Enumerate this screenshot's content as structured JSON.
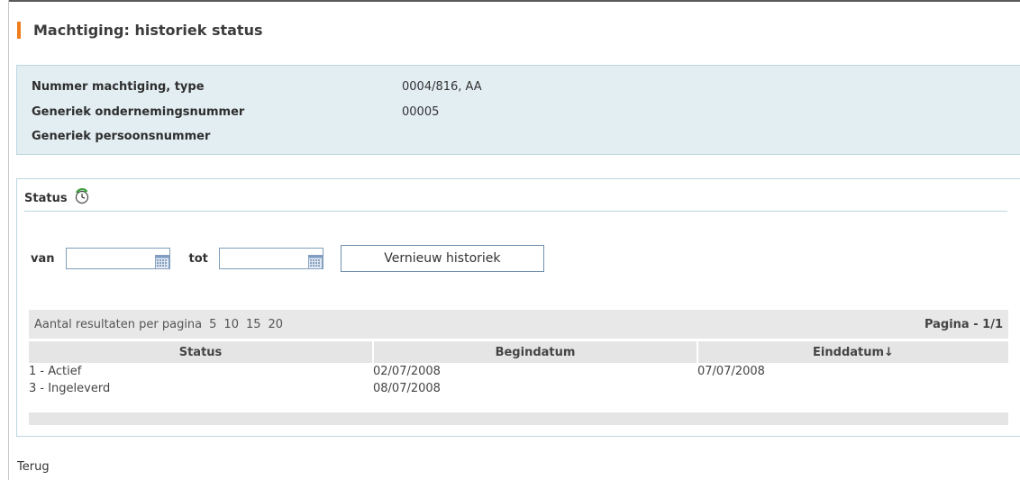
{
  "page": {
    "title": "Machtiging: historiek status"
  },
  "info": {
    "rows": [
      {
        "label": "Nummer machtiging, type",
        "value": "0004/816, AA"
      },
      {
        "label": "Generiek ondernemingsnummer",
        "value": "00005"
      },
      {
        "label": "Generiek persoonsnummer",
        "value": ""
      }
    ]
  },
  "status_section": {
    "title": "Status",
    "refresh_icon": "refresh-icon",
    "from_label": "van",
    "to_label": "tot",
    "from_value": "",
    "to_value": "",
    "renew_button": "Vernieuw historiek"
  },
  "pager": {
    "label": "Aantal resultaten per pagina",
    "options": [
      "5",
      "10",
      "15",
      "20"
    ],
    "page_info": "Pagina - 1/1"
  },
  "table": {
    "columns": [
      "Status",
      "Begindatum",
      "Einddatum↓"
    ],
    "rows": [
      [
        "1  - Actief",
        "02/07/2008",
        "07/07/2008"
      ],
      [
        "3  - Ingeleverd",
        "08/07/2008",
        ""
      ]
    ]
  },
  "footer": {
    "back_link": "Terug"
  },
  "colors": {
    "accent": "#f07d1c",
    "info_bg": "#e3eef3",
    "border": "#bcd6e0"
  }
}
